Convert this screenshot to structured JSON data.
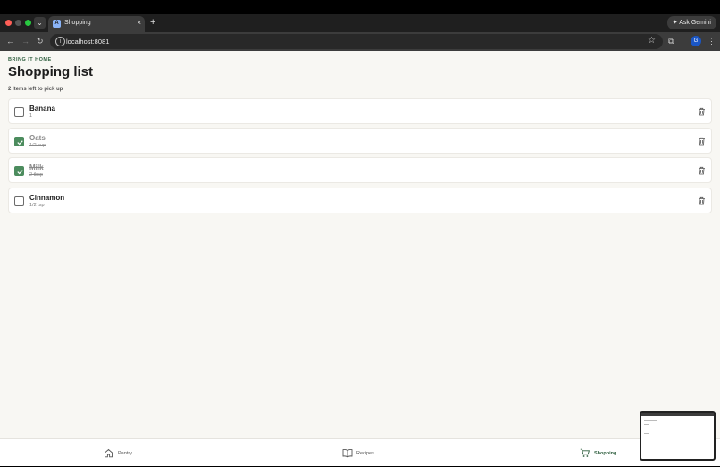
{
  "browser": {
    "tab_title": "Shopping",
    "tab_favicon": "A",
    "new_tab_label": "+",
    "close_tab_label": "×",
    "gemini_label": "Ask Gemini",
    "url": "localhost:8081",
    "profile_initial": "G"
  },
  "page": {
    "eyebrow": "BRING IT HOME",
    "title": "Shopping list",
    "subtitle": "2 items left to pick up",
    "items": [
      {
        "name": "Banana",
        "qty": "1",
        "checked": false
      },
      {
        "name": "Oats",
        "qty": "1/2 cup",
        "checked": true
      },
      {
        "name": "Milk",
        "qty": "2 tbsp",
        "checked": true
      },
      {
        "name": "Cinnamon",
        "qty": "1/2 tsp",
        "checked": false
      }
    ]
  },
  "nav": {
    "tabs": [
      {
        "label": "Pantry",
        "icon": "home-icon",
        "active": false
      },
      {
        "label": "Recipes",
        "icon": "book-icon",
        "active": false
      },
      {
        "label": "Shopping",
        "icon": "cart-icon",
        "active": true
      }
    ]
  },
  "colors": {
    "accent": "#4c8c5e",
    "accent_text": "#2f5f3f",
    "background": "#f8f7f3"
  }
}
